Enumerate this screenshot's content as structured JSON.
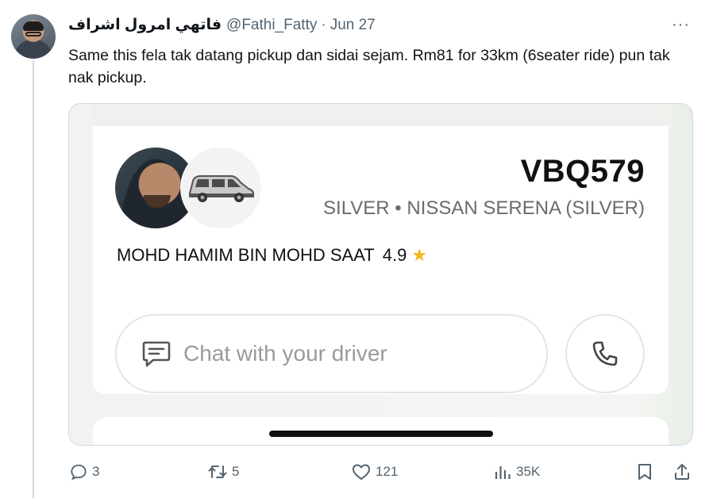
{
  "tweet": {
    "author_name": "فاتهي امرول اشراف",
    "handle": "@Fathi_Fatty",
    "separator": "·",
    "date": "Jun 27",
    "more": "···",
    "text": "Same this fela tak datang pickup dan sidai sejam. Rm81 for 33km (6seater ride) pun tak nak pickup."
  },
  "ride_card": {
    "plate": "VBQ579",
    "vehicle": "SILVER • NISSAN SERENA (SILVER)",
    "driver_name": "MOHD HAMIM BIN MOHD SAAT",
    "rating": "4.9",
    "star": "★",
    "chat_placeholder": "Chat with your driver"
  },
  "actions": {
    "replies": "3",
    "retweets": "5",
    "likes": "121",
    "views": "35K"
  },
  "icons": [
    "reply-icon",
    "retweet-icon",
    "like-icon",
    "views-icon",
    "bookmark-icon",
    "share-icon",
    "chat-bubble-icon",
    "phone-icon",
    "car-icon"
  ],
  "colors": {
    "muted": "#536471",
    "star": "#f4b41a",
    "text": "#0f1419"
  }
}
